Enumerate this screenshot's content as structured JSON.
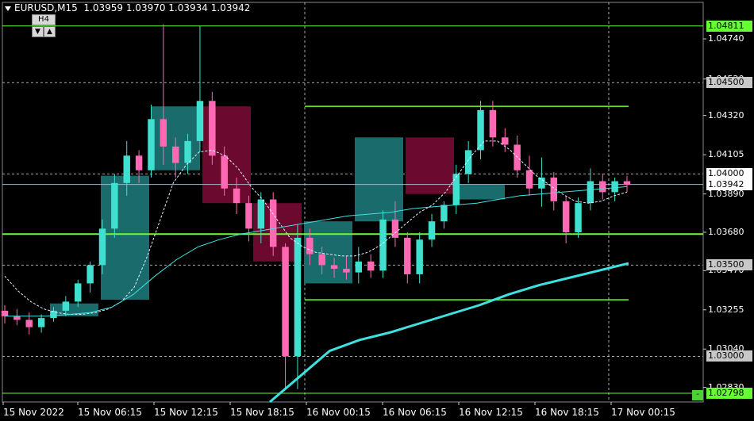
{
  "header": {
    "symbol_tf": "EURUSD,M15",
    "ohlc": "1.03959 1.03970 1.03934 1.03942"
  },
  "timeframe_box": {
    "label": "H4",
    "down_arrow": "▼",
    "up_arrow": "▲"
  },
  "price_axis": {
    "ticks": [
      {
        "price": 1.0474,
        "label": "1.04740",
        "style": "plain"
      },
      {
        "price": 1.0452,
        "label": "1.04520",
        "style": "plain"
      },
      {
        "price": 1.0432,
        "label": "1.04320",
        "style": "plain"
      },
      {
        "price": 1.04105,
        "label": "1.04105",
        "style": "plain"
      },
      {
        "price": 1.0389,
        "label": "1.03890",
        "style": "plain"
      },
      {
        "price": 1.0368,
        "label": "1.03680",
        "style": "plain"
      },
      {
        "price": 1.0347,
        "label": "1.03470",
        "style": "plain"
      },
      {
        "price": 1.03255,
        "label": "1.03255",
        "style": "plain"
      },
      {
        "price": 1.0304,
        "label": "1.03040",
        "style": "plain"
      },
      {
        "price": 1.0283,
        "label": "1.02830",
        "style": "plain"
      }
    ],
    "labels": [
      {
        "price": 1.04811,
        "label": "1.04811",
        "bg": "#66ff33"
      },
      {
        "price": 1.045,
        "label": "1.04500",
        "bg": "#c8c8c8"
      },
      {
        "price": 1.04,
        "label": "1.04000",
        "bg": "#ffffff"
      },
      {
        "price": 1.03942,
        "label": "1.03942",
        "bg": "#ffffff"
      },
      {
        "price": 1.035,
        "label": "1.03500",
        "bg": "#c8c8c8"
      },
      {
        "price": 1.03,
        "label": "1.03000",
        "bg": "#c8c8c8"
      },
      {
        "price": 1.02798,
        "label": "1.02798",
        "bg": "#66ff33"
      }
    ],
    "minus_button": "-"
  },
  "time_axis": {
    "labels": [
      "15 Nov 2022",
      "15 Nov 06:15",
      "15 Nov 12:15",
      "15 Nov 18:15",
      "16 Nov 00:15",
      "16 Nov 06:15",
      "16 Nov 12:15",
      "16 Nov 18:15",
      "17 Nov 00:15"
    ]
  },
  "colors": {
    "bull_candle": "#40e0d0",
    "bear_candle": "#ff69b4",
    "h4_bull_box": "#1a6b6b",
    "h4_bear_box": "#6b0a2e",
    "green_level": "#66ff33",
    "ma_slow": "#40e0e0",
    "grid_dotted": "#aaaaaa"
  },
  "chart_data": {
    "type": "candlestick",
    "symbol": "EURUSD",
    "timeframe": "M15",
    "ylim": [
      1.0275,
      1.0494
    ],
    "levels": {
      "green_horizontal": [
        1.04811,
        1.0367,
        1.02798
      ],
      "green_segments": [
        {
          "price": 1.0437,
          "from": "16 Nov 00:15",
          "to": "17 Nov 00:15"
        },
        {
          "price": 1.0331,
          "from": "16 Nov 00:15",
          "to": "17 Nov 00:15"
        }
      ],
      "dotted_horizontal": [
        1.045,
        1.04,
        1.035,
        1.03
      ],
      "current_price": 1.03942
    },
    "h4_boxes": [
      {
        "open": 1.0322,
        "close": 1.0329,
        "dir": "bull"
      },
      {
        "open": 1.0331,
        "close": 1.0399,
        "dir": "bull"
      },
      {
        "open": 1.0402,
        "close": 1.0437,
        "dir": "bull"
      },
      {
        "open": 1.0437,
        "close": 1.0384,
        "dir": "bear"
      },
      {
        "open": 1.0384,
        "close": 1.0352,
        "dir": "bear"
      },
      {
        "open": 1.034,
        "close": 1.0374,
        "dir": "bull"
      },
      {
        "open": 1.0374,
        "close": 1.042,
        "dir": "bull"
      },
      {
        "open": 1.042,
        "close": 1.0389,
        "dir": "bear"
      },
      {
        "open": 1.0386,
        "close": 1.0394,
        "dir": "bull"
      }
    ],
    "ma_fast": [
      1.0344,
      1.0336,
      1.033,
      1.0326,
      1.0324,
      1.0323,
      1.0323,
      1.0324,
      1.0326,
      1.033,
      1.0338,
      1.0355,
      1.0375,
      1.0395,
      1.0405,
      1.0412,
      1.0413,
      1.041,
      1.0403,
      1.0393,
      1.0385,
      1.0375,
      1.0365,
      1.036,
      1.0357,
      1.0356,
      1.0355,
      1.0355,
      1.0357,
      1.0361,
      1.0367,
      1.0373,
      1.0379,
      1.0383,
      1.039,
      1.04,
      1.041,
      1.0418,
      1.0418,
      1.0413,
      1.0406,
      1.0399,
      1.0394,
      1.0389,
      1.0385,
      1.0384,
      1.0385,
      1.0388,
      1.039
    ],
    "ma_mid": [
      1.0322,
      1.0322,
      1.0322,
      1.0323,
      1.0324,
      1.0327,
      1.0334,
      1.0344,
      1.0353,
      1.036,
      1.0364,
      1.0367,
      1.0369,
      1.0371,
      1.0373,
      1.0375,
      1.0377,
      1.0378,
      1.0379,
      1.0381,
      1.0382,
      1.0383,
      1.0384,
      1.0386,
      1.0388,
      1.0389,
      1.039,
      1.0391,
      1.0392,
      1.0393
    ],
    "ma_slow": [
      1.0275,
      1.0289,
      1.0303,
      1.0309,
      1.0313,
      1.0318,
      1.0323,
      1.0328,
      1.0334,
      1.0339,
      1.0343,
      1.0347,
      1.0351
    ],
    "candles": [
      {
        "o": 1.0325,
        "h": 1.0328,
        "l": 1.0318,
        "c": 1.0322
      },
      {
        "o": 1.0322,
        "h": 1.0326,
        "l": 1.0317,
        "c": 1.032
      },
      {
        "o": 1.032,
        "h": 1.0324,
        "l": 1.0312,
        "c": 1.0316
      },
      {
        "o": 1.0316,
        "h": 1.0323,
        "l": 1.0313,
        "c": 1.0321
      },
      {
        "o": 1.0321,
        "h": 1.0327,
        "l": 1.0319,
        "c": 1.0325
      },
      {
        "o": 1.0325,
        "h": 1.0333,
        "l": 1.0322,
        "c": 1.033
      },
      {
        "o": 1.033,
        "h": 1.0342,
        "l": 1.0327,
        "c": 1.034
      },
      {
        "o": 1.034,
        "h": 1.0352,
        "l": 1.0335,
        "c": 1.035
      },
      {
        "o": 1.035,
        "h": 1.0375,
        "l": 1.0345,
        "c": 1.037
      },
      {
        "o": 1.037,
        "h": 1.04,
        "l": 1.0365,
        "c": 1.0395
      },
      {
        "o": 1.0395,
        "h": 1.0418,
        "l": 1.0388,
        "c": 1.041
      },
      {
        "o": 1.041,
        "h": 1.0413,
        "l": 1.0395,
        "c": 1.0402
      },
      {
        "o": 1.0402,
        "h": 1.0438,
        "l": 1.0398,
        "c": 1.043
      },
      {
        "o": 1.043,
        "h": 1.0482,
        "l": 1.0405,
        "c": 1.0415
      },
      {
        "o": 1.0415,
        "h": 1.042,
        "l": 1.0398,
        "c": 1.0406
      },
      {
        "o": 1.0406,
        "h": 1.0422,
        "l": 1.04,
        "c": 1.0418
      },
      {
        "o": 1.0418,
        "h": 1.0481,
        "l": 1.0412,
        "c": 1.044
      },
      {
        "o": 1.044,
        "h": 1.0445,
        "l": 1.0405,
        "c": 1.041
      },
      {
        "o": 1.041,
        "h": 1.0415,
        "l": 1.0388,
        "c": 1.0392
      },
      {
        "o": 1.0392,
        "h": 1.0398,
        "l": 1.0378,
        "c": 1.0384
      },
      {
        "o": 1.0384,
        "h": 1.0388,
        "l": 1.0363,
        "c": 1.037
      },
      {
        "o": 1.037,
        "h": 1.039,
        "l": 1.0362,
        "c": 1.0386
      },
      {
        "o": 1.0386,
        "h": 1.039,
        "l": 1.0355,
        "c": 1.036
      },
      {
        "o": 1.036,
        "h": 1.0362,
        "l": 1.0282,
        "c": 1.03
      },
      {
        "o": 1.03,
        "h": 1.0372,
        "l": 1.0282,
        "c": 1.0365
      },
      {
        "o": 1.0365,
        "h": 1.037,
        "l": 1.035,
        "c": 1.0356
      },
      {
        "o": 1.0356,
        "h": 1.036,
        "l": 1.0345,
        "c": 1.035
      },
      {
        "o": 1.035,
        "h": 1.0354,
        "l": 1.0343,
        "c": 1.0348
      },
      {
        "o": 1.0348,
        "h": 1.0355,
        "l": 1.0342,
        "c": 1.0346
      },
      {
        "o": 1.0346,
        "h": 1.036,
        "l": 1.034,
        "c": 1.0352
      },
      {
        "o": 1.0352,
        "h": 1.0356,
        "l": 1.0343,
        "c": 1.0347
      },
      {
        "o": 1.0347,
        "h": 1.038,
        "l": 1.0343,
        "c": 1.0375
      },
      {
        "o": 1.0375,
        "h": 1.0385,
        "l": 1.036,
        "c": 1.0365
      },
      {
        "o": 1.0365,
        "h": 1.0368,
        "l": 1.034,
        "c": 1.0345
      },
      {
        "o": 1.0345,
        "h": 1.0368,
        "l": 1.034,
        "c": 1.0364
      },
      {
        "o": 1.0364,
        "h": 1.0378,
        "l": 1.036,
        "c": 1.0374
      },
      {
        "o": 1.0374,
        "h": 1.0385,
        "l": 1.037,
        "c": 1.0383
      },
      {
        "o": 1.0383,
        "h": 1.0405,
        "l": 1.0378,
        "c": 1.04
      },
      {
        "o": 1.04,
        "h": 1.0418,
        "l": 1.0395,
        "c": 1.0413
      },
      {
        "o": 1.0413,
        "h": 1.044,
        "l": 1.0408,
        "c": 1.0435
      },
      {
        "o": 1.0435,
        "h": 1.044,
        "l": 1.0415,
        "c": 1.042
      },
      {
        "o": 1.042,
        "h": 1.0425,
        "l": 1.0412,
        "c": 1.0416
      },
      {
        "o": 1.0416,
        "h": 1.0421,
        "l": 1.0398,
        "c": 1.0402
      },
      {
        "o": 1.0402,
        "h": 1.041,
        "l": 1.0388,
        "c": 1.0392
      },
      {
        "o": 1.0392,
        "h": 1.0409,
        "l": 1.0382,
        "c": 1.0398
      },
      {
        "o": 1.0398,
        "h": 1.0401,
        "l": 1.038,
        "c": 1.0385
      },
      {
        "o": 1.0385,
        "h": 1.0388,
        "l": 1.0362,
        "c": 1.0368
      },
      {
        "o": 1.0368,
        "h": 1.0387,
        "l": 1.0365,
        "c": 1.0384
      },
      {
        "o": 1.0384,
        "h": 1.0403,
        "l": 1.038,
        "c": 1.0396
      },
      {
        "o": 1.0396,
        "h": 1.04,
        "l": 1.0386,
        "c": 1.039
      },
      {
        "o": 1.039,
        "h": 1.0398,
        "l": 1.0385,
        "c": 1.0396
      },
      {
        "o": 1.0396,
        "h": 1.0399,
        "l": 1.039,
        "c": 1.0394
      }
    ]
  }
}
